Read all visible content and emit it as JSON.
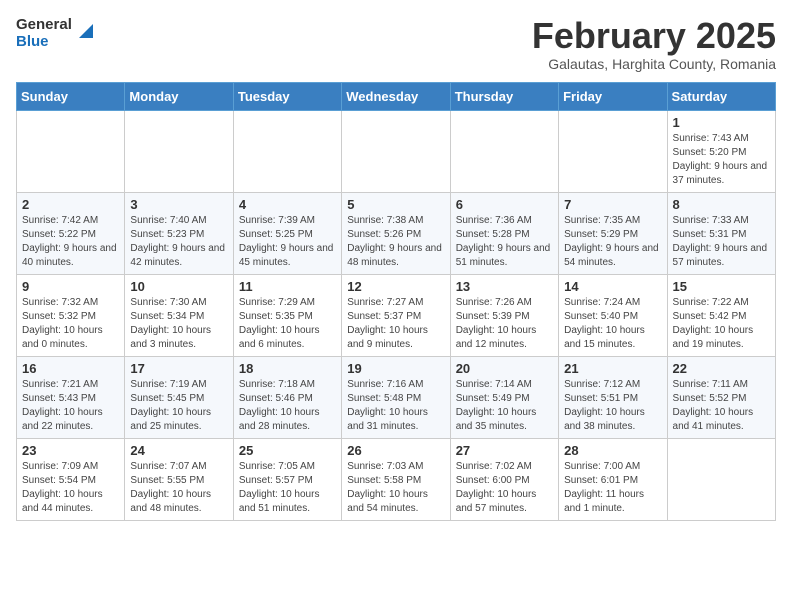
{
  "header": {
    "logo_general": "General",
    "logo_blue": "Blue",
    "month_title": "February 2025",
    "subtitle": "Galautas, Harghita County, Romania"
  },
  "weekdays": [
    "Sunday",
    "Monday",
    "Tuesday",
    "Wednesday",
    "Thursday",
    "Friday",
    "Saturday"
  ],
  "weeks": [
    [
      {
        "day": "",
        "info": ""
      },
      {
        "day": "",
        "info": ""
      },
      {
        "day": "",
        "info": ""
      },
      {
        "day": "",
        "info": ""
      },
      {
        "day": "",
        "info": ""
      },
      {
        "day": "",
        "info": ""
      },
      {
        "day": "1",
        "info": "Sunrise: 7:43 AM\nSunset: 5:20 PM\nDaylight: 9 hours and 37 minutes."
      }
    ],
    [
      {
        "day": "2",
        "info": "Sunrise: 7:42 AM\nSunset: 5:22 PM\nDaylight: 9 hours and 40 minutes."
      },
      {
        "day": "3",
        "info": "Sunrise: 7:40 AM\nSunset: 5:23 PM\nDaylight: 9 hours and 42 minutes."
      },
      {
        "day": "4",
        "info": "Sunrise: 7:39 AM\nSunset: 5:25 PM\nDaylight: 9 hours and 45 minutes."
      },
      {
        "day": "5",
        "info": "Sunrise: 7:38 AM\nSunset: 5:26 PM\nDaylight: 9 hours and 48 minutes."
      },
      {
        "day": "6",
        "info": "Sunrise: 7:36 AM\nSunset: 5:28 PM\nDaylight: 9 hours and 51 minutes."
      },
      {
        "day": "7",
        "info": "Sunrise: 7:35 AM\nSunset: 5:29 PM\nDaylight: 9 hours and 54 minutes."
      },
      {
        "day": "8",
        "info": "Sunrise: 7:33 AM\nSunset: 5:31 PM\nDaylight: 9 hours and 57 minutes."
      }
    ],
    [
      {
        "day": "9",
        "info": "Sunrise: 7:32 AM\nSunset: 5:32 PM\nDaylight: 10 hours and 0 minutes."
      },
      {
        "day": "10",
        "info": "Sunrise: 7:30 AM\nSunset: 5:34 PM\nDaylight: 10 hours and 3 minutes."
      },
      {
        "day": "11",
        "info": "Sunrise: 7:29 AM\nSunset: 5:35 PM\nDaylight: 10 hours and 6 minutes."
      },
      {
        "day": "12",
        "info": "Sunrise: 7:27 AM\nSunset: 5:37 PM\nDaylight: 10 hours and 9 minutes."
      },
      {
        "day": "13",
        "info": "Sunrise: 7:26 AM\nSunset: 5:39 PM\nDaylight: 10 hours and 12 minutes."
      },
      {
        "day": "14",
        "info": "Sunrise: 7:24 AM\nSunset: 5:40 PM\nDaylight: 10 hours and 15 minutes."
      },
      {
        "day": "15",
        "info": "Sunrise: 7:22 AM\nSunset: 5:42 PM\nDaylight: 10 hours and 19 minutes."
      }
    ],
    [
      {
        "day": "16",
        "info": "Sunrise: 7:21 AM\nSunset: 5:43 PM\nDaylight: 10 hours and 22 minutes."
      },
      {
        "day": "17",
        "info": "Sunrise: 7:19 AM\nSunset: 5:45 PM\nDaylight: 10 hours and 25 minutes."
      },
      {
        "day": "18",
        "info": "Sunrise: 7:18 AM\nSunset: 5:46 PM\nDaylight: 10 hours and 28 minutes."
      },
      {
        "day": "19",
        "info": "Sunrise: 7:16 AM\nSunset: 5:48 PM\nDaylight: 10 hours and 31 minutes."
      },
      {
        "day": "20",
        "info": "Sunrise: 7:14 AM\nSunset: 5:49 PM\nDaylight: 10 hours and 35 minutes."
      },
      {
        "day": "21",
        "info": "Sunrise: 7:12 AM\nSunset: 5:51 PM\nDaylight: 10 hours and 38 minutes."
      },
      {
        "day": "22",
        "info": "Sunrise: 7:11 AM\nSunset: 5:52 PM\nDaylight: 10 hours and 41 minutes."
      }
    ],
    [
      {
        "day": "23",
        "info": "Sunrise: 7:09 AM\nSunset: 5:54 PM\nDaylight: 10 hours and 44 minutes."
      },
      {
        "day": "24",
        "info": "Sunrise: 7:07 AM\nSunset: 5:55 PM\nDaylight: 10 hours and 48 minutes."
      },
      {
        "day": "25",
        "info": "Sunrise: 7:05 AM\nSunset: 5:57 PM\nDaylight: 10 hours and 51 minutes."
      },
      {
        "day": "26",
        "info": "Sunrise: 7:03 AM\nSunset: 5:58 PM\nDaylight: 10 hours and 54 minutes."
      },
      {
        "day": "27",
        "info": "Sunrise: 7:02 AM\nSunset: 6:00 PM\nDaylight: 10 hours and 57 minutes."
      },
      {
        "day": "28",
        "info": "Sunrise: 7:00 AM\nSunset: 6:01 PM\nDaylight: 11 hours and 1 minute."
      },
      {
        "day": "",
        "info": ""
      }
    ]
  ]
}
